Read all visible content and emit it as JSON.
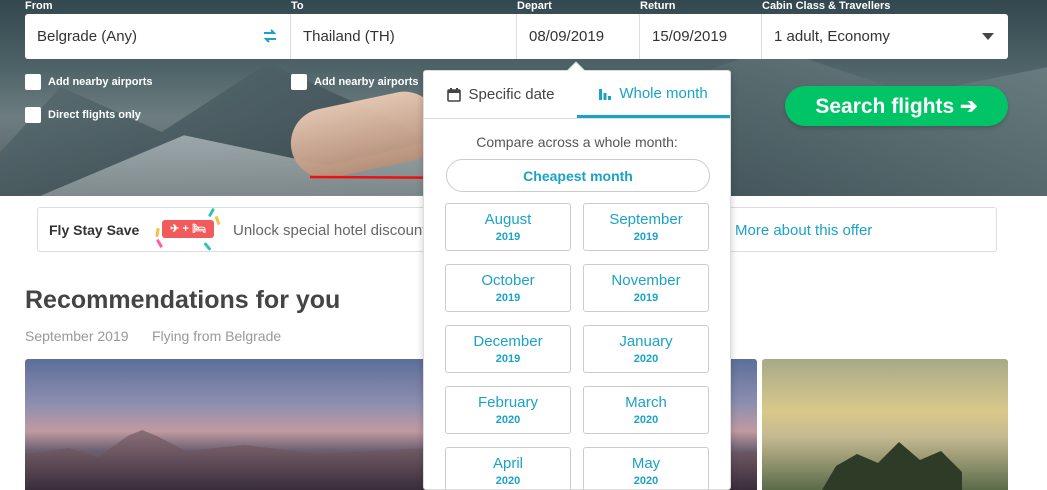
{
  "search": {
    "labels": {
      "from": "From",
      "to": "To",
      "depart": "Depart",
      "return": "Return",
      "cabin": "Cabin Class & Travellers"
    },
    "from_value": "Belgrade (Any)",
    "to_value": "Thailand (TH)",
    "depart_value": "08/09/2019",
    "return_value": "15/09/2019",
    "cabin_value": "1 adult, Economy",
    "add_nearby_from": "Add nearby airports",
    "add_nearby_to": "Add nearby airports",
    "direct_only": "Direct flights only",
    "search_button": "Search flights ➔"
  },
  "popup": {
    "tab_specific": "Specific date",
    "tab_whole": "Whole month",
    "compare_text": "Compare across a whole month:",
    "cheapest": "Cheapest month",
    "months": [
      {
        "name": "August",
        "year": "2019"
      },
      {
        "name": "September",
        "year": "2019"
      },
      {
        "name": "October",
        "year": "2019"
      },
      {
        "name": "November",
        "year": "2019"
      },
      {
        "name": "December",
        "year": "2019"
      },
      {
        "name": "January",
        "year": "2020"
      },
      {
        "name": "February",
        "year": "2020"
      },
      {
        "name": "March",
        "year": "2020"
      },
      {
        "name": "April",
        "year": "2020"
      },
      {
        "name": "May",
        "year": "2020"
      }
    ]
  },
  "banner": {
    "title": "Fly Stay Save",
    "badge": "✈ + 🛏",
    "text": "Unlock special hotel discount",
    "link": "More about this offer"
  },
  "recommendations": {
    "title": "Recommendations for you",
    "month": "September 2019",
    "origin": "Flying from Belgrade"
  },
  "colors": {
    "accent": "#1aa3c7",
    "cta": "#00c466",
    "badge": "#f25b5b"
  }
}
